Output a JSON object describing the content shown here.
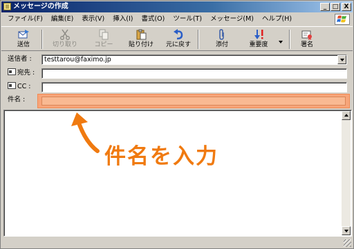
{
  "window": {
    "title": "メッセージの作成"
  },
  "titlebar_buttons": [
    "_",
    "□",
    "X"
  ],
  "menu": [
    "ファイル(F)",
    "編集(E)",
    "表示(V)",
    "挿入(I)",
    "書式(O)",
    "ツール(T)",
    "メッセージ(M)",
    "ヘルプ(H)"
  ],
  "toolbar": {
    "send": "送信",
    "cut": "切り取り",
    "copy": "コピー",
    "paste": "貼り付け",
    "undo": "元に戻す",
    "attach": "添付",
    "priority": "重要度",
    "sign": "署名"
  },
  "icons": {
    "send": "send-icon",
    "cut": "scissors-icon",
    "copy": "copy-icon",
    "paste": "clipboard-icon",
    "undo": "undo-icon",
    "attach": "paperclip-icon",
    "priority": "priority-icon",
    "sign": "certificate-icon"
  },
  "header": {
    "from_label": "送信者 :",
    "from_value": "testtarou@faximo.jp",
    "to_label": "宛先 :",
    "to_value": "",
    "cc_label": "CC :",
    "cc_value": "",
    "subject_label": "件名 :",
    "subject_value": ""
  },
  "annotation": {
    "text": "件名を入力",
    "color": "#f07a10",
    "highlight_color": "#f7a57a"
  },
  "colors": {
    "title_bar": "#0a246a",
    "chrome": "#d4d0c8"
  }
}
